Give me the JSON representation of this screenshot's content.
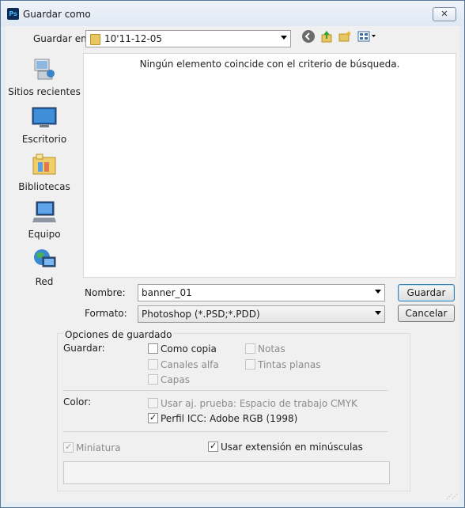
{
  "window": {
    "title": "Guardar como",
    "app_icon": "Ps",
    "close_label": "✕"
  },
  "save_in": {
    "label": "Guardar en:",
    "value": "10'11-12-05"
  },
  "toolbar": {
    "icons": [
      "back-icon",
      "up-folder-icon",
      "new-folder-icon",
      "view-menu-icon"
    ]
  },
  "places": [
    {
      "label": "Sitios recientes",
      "icon": "recent-places-icon"
    },
    {
      "label": "Escritorio",
      "icon": "desktop-icon"
    },
    {
      "label": "Bibliotecas",
      "icon": "libraries-icon"
    },
    {
      "label": "Equipo",
      "icon": "computer-icon"
    },
    {
      "label": "Red",
      "icon": "network-icon"
    }
  ],
  "file_list": {
    "empty_message": "Ningún elemento coincide con el criterio de búsqueda."
  },
  "filename": {
    "label": "Nombre:",
    "value": "banner_01"
  },
  "format": {
    "label": "Formato:",
    "value": "Photoshop (*.PSD;*.PDD)"
  },
  "buttons": {
    "save": "Guardar",
    "cancel": "Cancelar"
  },
  "options": {
    "title": "Opciones de guardado",
    "save_label": "Guardar:",
    "as_copy": {
      "label": "Como copia",
      "checked": false,
      "enabled": true
    },
    "notes": {
      "label": "Notas",
      "checked": false,
      "enabled": false
    },
    "alpha": {
      "label": "Canales alfa",
      "checked": false,
      "enabled": false
    },
    "spot": {
      "label": "Tintas planas",
      "checked": false,
      "enabled": false
    },
    "layers": {
      "label": "Capas",
      "checked": false,
      "enabled": false
    },
    "color_label": "Color:",
    "proof": {
      "label": "Usar aj. prueba: Espacio de trabajo CMYK",
      "checked": false,
      "enabled": false
    },
    "icc": {
      "label": "Perfil ICC: Adobe RGB (1998)",
      "checked": true,
      "enabled": true
    },
    "thumbnail": {
      "label": "Miniatura",
      "checked": true,
      "enabled": false
    },
    "lowercase": {
      "label": "Usar extensión en minúsculas",
      "checked": true,
      "enabled": true
    }
  },
  "check_mark": "✓"
}
